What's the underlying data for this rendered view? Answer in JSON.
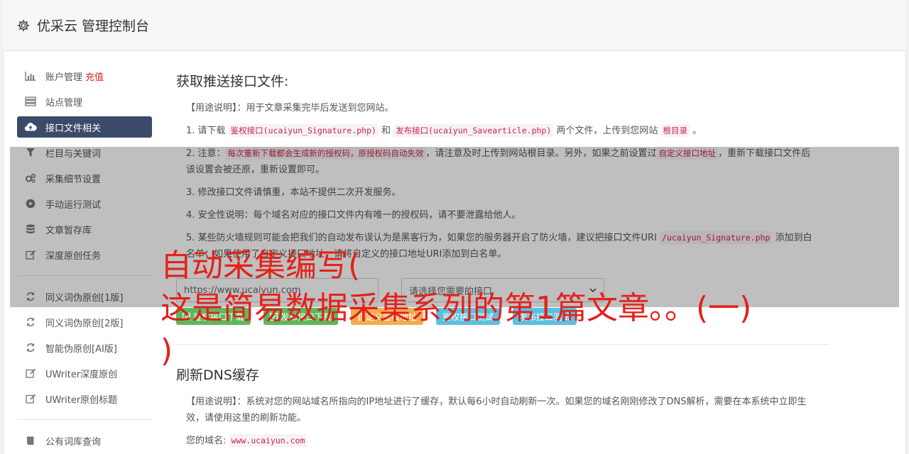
{
  "app": {
    "title": "优采云 管理控制台"
  },
  "sidebar": {
    "items": [
      {
        "label": "账户管理",
        "badge": "充值",
        "icon": "bar-chart-icon"
      },
      {
        "label": "站点管理",
        "icon": "server-icon"
      },
      {
        "label": "接口文件相关",
        "icon": "cloud-upload-icon",
        "active": true
      },
      {
        "label": "栏目与关键词",
        "icon": "filter-icon"
      },
      {
        "label": "采集细节设置",
        "icon": "cogs-icon"
      },
      {
        "label": "手动运行测试",
        "icon": "play-circle-icon"
      },
      {
        "label": "文章暂存库",
        "icon": "database-icon"
      },
      {
        "label": "深度原创任务",
        "icon": "edit-icon"
      }
    ],
    "items2": [
      {
        "label": "同义词伪原创[1版]",
        "icon": "refresh-icon"
      },
      {
        "label": "同义词伪原创[2版]",
        "icon": "refresh-icon"
      },
      {
        "label": "智能伪原创[AI版]",
        "icon": "refresh-icon"
      },
      {
        "label": "UWriter深度原创",
        "icon": "edit-icon"
      },
      {
        "label": "UWriter原创标题",
        "icon": "edit-icon"
      }
    ],
    "items3": [
      {
        "label": "公有词库查询",
        "icon": "book-icon"
      }
    ]
  },
  "section1": {
    "title": "获取推送接口文件:",
    "usage_label": "【用途说明】",
    "usage_text": "：用于文章采集完毕后发送到您网站。",
    "step1_a": "1. 请下载 ",
    "step1_code1": "鉴权接口(ucaiyun_Signature.php)",
    "step1_b": " 和 ",
    "step1_code2": "发布接口(ucaiyun_Savearticle.php)",
    "step1_c": " 两个文件，上传到您网站 ",
    "step1_code3": "根目录",
    "step1_d": " 。",
    "step2_a": "2. 注意：",
    "step2_code1": "每次重新下载都会生成新的授权码，原授权码自动失效",
    "step2_b": "，请注意及时上传到网站根目录。另外，如果之前设置过",
    "step2_code2": "自定义接口地址",
    "step2_c": "，重新下载接口文件后该设置会被还原，重新设置即可。",
    "step3": "3. 修改接口文件请慎重，本站不提供二次开发服务。",
    "step4": "4. 安全性说明：每个域名对应的接口文件内有唯一的授权码，请不要泄露给他人。",
    "step5_a": "5. 某些防火墙规则可能会把我们的自动发布误认为是黑客行为，如果您的服务器开启了防火墙，建议把接口文件URI ",
    "step5_code": "/ucaiyun_Signature.php",
    "step5_b": " 添加到白名单；如果使用了自定义接口地址，请将自定义的接口地址URI添加到白名单。",
    "url_value": "https://www.ucaiyun.com",
    "select_placeholder": "请选择您需要的接口",
    "buttons": {
      "b1": "鉴权接口下载",
      "b2": "发布接口下载",
      "b3": "自定义鉴权地址",
      "b4": "鉴权接口测试",
      "b5": "发布接口测试"
    }
  },
  "section2": {
    "title": "刷新DNS缓存",
    "usage_label": "【用途说明】",
    "usage_text": "：系统对您的网站域名所指向的IP地址进行了缓存，默认每6小时自动刷新一次。如果您的域名刚刚修改了DNS解析，需要在本系统中立即生效，请使用这里的刷新功能。",
    "domain_label": "您的域名: ",
    "domain_value": "www.ucaiyun.com"
  },
  "overlay": {
    "line1": "自动采集编写(",
    "line2": "这是简易数据采集系列的第1篇文章。。(一)",
    "line3": ")"
  },
  "colors": {
    "active_bg": "#3b4a68",
    "recharge": "#d9231d",
    "overlay_text": "#e3211b"
  }
}
